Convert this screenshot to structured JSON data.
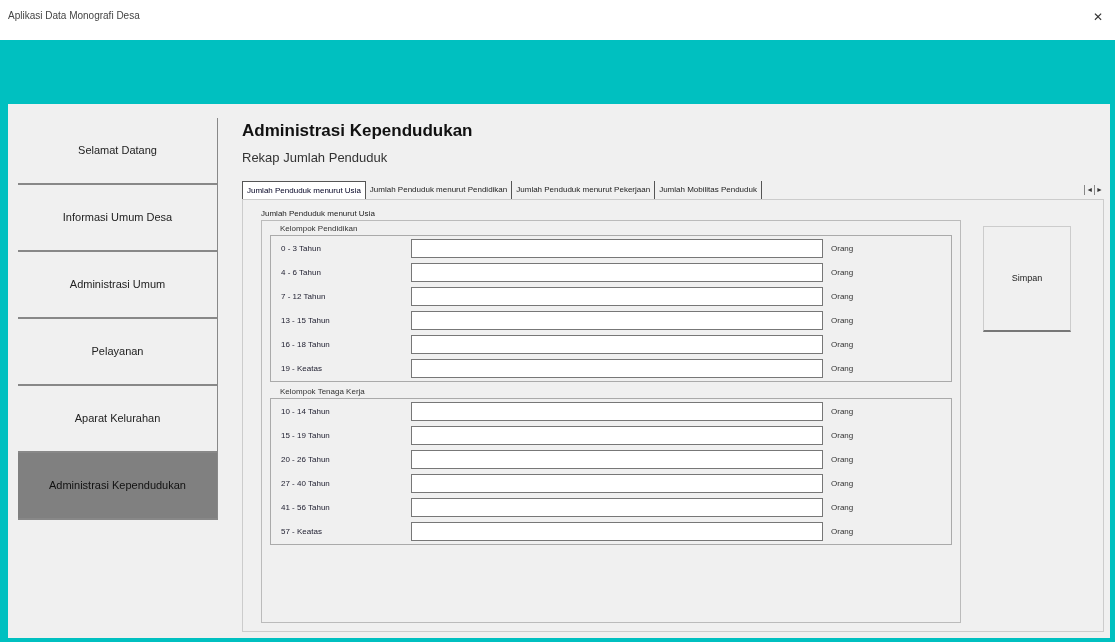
{
  "window": {
    "title": "Aplikasi Data Monografi Desa",
    "close": "✕"
  },
  "sidebar": {
    "items": [
      {
        "label": "Selamat Datang",
        "selected": false
      },
      {
        "label": "Informasi Umum Desa",
        "selected": false
      },
      {
        "label": "Administrasi Umum",
        "selected": false
      },
      {
        "label": "Pelayanan",
        "selected": false
      },
      {
        "label": "Aparat Kelurahan",
        "selected": false
      },
      {
        "label": "Administrasi Kependudukan",
        "selected": true
      }
    ]
  },
  "heading": "Administrasi Kependudukan",
  "subheading": "Rekap Jumlah Penduduk",
  "tabs": [
    {
      "label": "Jumlah Penduduk menurut Usia",
      "selected": true
    },
    {
      "label": "Jumlah Penduduk menurut Pendidikan",
      "selected": false
    },
    {
      "label": "Jumlah Penduduk menurut Pekerjaan",
      "selected": false
    },
    {
      "label": "Jumlah Mobilitas Penduduk",
      "selected": false
    }
  ],
  "tab_scroll": [
    "◄",
    "►"
  ],
  "frame": {
    "title": "Jumlah Penduduk menurut Usia",
    "groups": [
      {
        "title": "Kelompok Pendidikan",
        "rows": [
          {
            "label": "0 - 3 Tahun",
            "unit": "Orang"
          },
          {
            "label": "4 - 6 Tahun",
            "unit": "Orang"
          },
          {
            "label": "7 - 12 Tahun",
            "unit": "Orang"
          },
          {
            "label": "13 - 15 Tahun",
            "unit": "Orang"
          },
          {
            "label": "16 - 18 Tahun",
            "unit": "Orang"
          },
          {
            "label": "19 - Keatas",
            "unit": "Orang"
          }
        ]
      },
      {
        "title": "Kelompok Tenaga Kerja",
        "rows": [
          {
            "label": "10 - 14 Tahun",
            "unit": "Orang"
          },
          {
            "label": "15 - 19 Tahun",
            "unit": "Orang"
          },
          {
            "label": "20 - 26 Tahun",
            "unit": "Orang"
          },
          {
            "label": "27 - 40 Tahun",
            "unit": "Orang"
          },
          {
            "label": "41 - 56 Tahun",
            "unit": "Orang"
          },
          {
            "label": "57 - Keatas",
            "unit": "Orang"
          }
        ]
      }
    ]
  },
  "save_button": "Simpan"
}
